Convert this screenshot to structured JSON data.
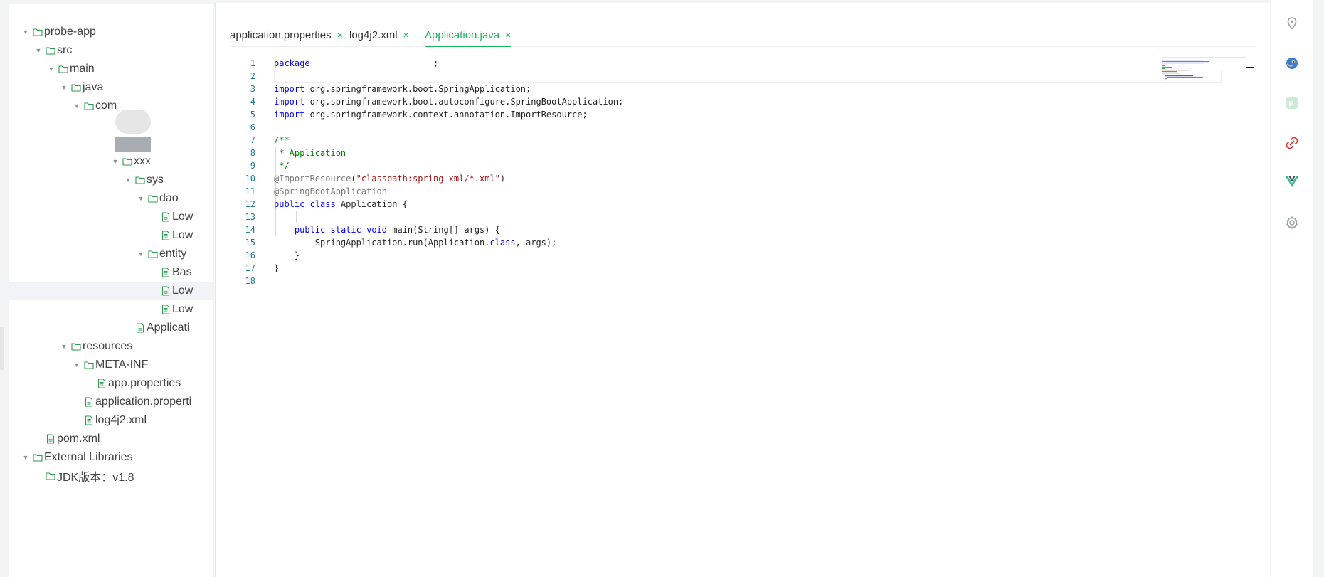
{
  "tree": {
    "items": [
      {
        "label": "probe-app",
        "depth": 0,
        "kind": "folder",
        "expanded": true
      },
      {
        "label": "src",
        "depth": 1,
        "kind": "folder",
        "expanded": true
      },
      {
        "label": "main",
        "depth": 2,
        "kind": "folder",
        "expanded": true
      },
      {
        "label": "java",
        "depth": 3,
        "kind": "folder",
        "expanded": true
      },
      {
        "label": "com",
        "depth": 4,
        "kind": "folder",
        "expanded": true
      },
      {
        "label": "xxx",
        "depth": 7,
        "kind": "folder",
        "expanded": true
      },
      {
        "label": "sys",
        "depth": 8,
        "kind": "folder",
        "expanded": true
      },
      {
        "label": "dao",
        "depth": 9,
        "kind": "folder",
        "expanded": true
      },
      {
        "label": "Low",
        "depth": 10,
        "kind": "file"
      },
      {
        "label": "Low",
        "depth": 10,
        "kind": "file"
      },
      {
        "label": "entity",
        "depth": 9,
        "kind": "folder",
        "expanded": true
      },
      {
        "label": "Bas",
        "depth": 10,
        "kind": "file"
      },
      {
        "label": "Low",
        "depth": 10,
        "kind": "file",
        "selected": true
      },
      {
        "label": "Low",
        "depth": 10,
        "kind": "file"
      },
      {
        "label": "Applicati",
        "depth": 8,
        "kind": "file"
      },
      {
        "label": "resources",
        "depth": 3,
        "kind": "folder",
        "expanded": true
      },
      {
        "label": "META-INF",
        "depth": 4,
        "kind": "folder",
        "expanded": true
      },
      {
        "label": "app.properties",
        "depth": 5,
        "kind": "file"
      },
      {
        "label": "application.properti",
        "depth": 4,
        "kind": "file"
      },
      {
        "label": "log4j2.xml",
        "depth": 4,
        "kind": "file"
      },
      {
        "label": "pom.xml",
        "depth": 1,
        "kind": "file"
      },
      {
        "label": "External Libraries",
        "depth": 0,
        "kind": "folder",
        "expanded": true
      },
      {
        "label": "JDK版本：v1.8",
        "depth": 1,
        "kind": "folder"
      }
    ]
  },
  "tabs": [
    {
      "label": "application.properties",
      "close": "×",
      "active": false
    },
    {
      "label": "log4j2.xml",
      "close": "×",
      "active": false
    },
    {
      "label": "Application.java",
      "close": "×",
      "active": true
    }
  ],
  "editor": {
    "lines": [
      {
        "n": "1",
        "tokens": [
          {
            "t": "package",
            "c": "kw"
          },
          {
            "t": "                        ;",
            "c": ""
          }
        ]
      },
      {
        "n": "2",
        "tokens": []
      },
      {
        "n": "3",
        "tokens": [
          {
            "t": "import",
            "c": "kw"
          },
          {
            "t": " org.springframework.boot.SpringApplication;",
            "c": ""
          }
        ]
      },
      {
        "n": "4",
        "tokens": [
          {
            "t": "import",
            "c": "kw"
          },
          {
            "t": " org.springframework.boot.autoconfigure.SpringBootApplication;",
            "c": ""
          }
        ]
      },
      {
        "n": "5",
        "tokens": [
          {
            "t": "import",
            "c": "kw"
          },
          {
            "t": " org.springframework.context.annotation.ImportResource;",
            "c": ""
          }
        ]
      },
      {
        "n": "6",
        "tokens": []
      },
      {
        "n": "7",
        "tokens": [
          {
            "t": "/**",
            "c": "cm"
          }
        ]
      },
      {
        "n": "8",
        "tokens": [
          {
            "t": " * Application",
            "c": "cm"
          }
        ]
      },
      {
        "n": "9",
        "tokens": [
          {
            "t": " */",
            "c": "cm"
          }
        ]
      },
      {
        "n": "10",
        "tokens": [
          {
            "t": "@ImportResource",
            "c": "an"
          },
          {
            "t": "(",
            "c": ""
          },
          {
            "t": "\"classpath:spring-xml/*.xml\"",
            "c": "st"
          },
          {
            "t": ")",
            "c": ""
          }
        ]
      },
      {
        "n": "11",
        "tokens": [
          {
            "t": "@SpringBootApplication",
            "c": "an"
          }
        ]
      },
      {
        "n": "12",
        "tokens": [
          {
            "t": "public",
            "c": "kw"
          },
          {
            "t": " ",
            "c": ""
          },
          {
            "t": "class",
            "c": "kw"
          },
          {
            "t": " Application {",
            "c": ""
          }
        ]
      },
      {
        "n": "13",
        "tokens": []
      },
      {
        "n": "14",
        "tokens": [
          {
            "t": "    ",
            "c": ""
          },
          {
            "t": "public",
            "c": "kw"
          },
          {
            "t": " ",
            "c": ""
          },
          {
            "t": "static",
            "c": "kw"
          },
          {
            "t": " ",
            "c": ""
          },
          {
            "t": "void",
            "c": "kw"
          },
          {
            "t": " main(String[] args) {",
            "c": ""
          }
        ]
      },
      {
        "n": "15",
        "tokens": [
          {
            "t": "        SpringApplication.run(Application.",
            "c": ""
          },
          {
            "t": "class",
            "c": "kw"
          },
          {
            "t": ", args);",
            "c": ""
          }
        ]
      },
      {
        "n": "16",
        "tokens": [
          {
            "t": "    }",
            "c": ""
          }
        ]
      },
      {
        "n": "17",
        "tokens": [
          {
            "t": "}",
            "c": ""
          }
        ]
      },
      {
        "n": "18",
        "tokens": []
      }
    ]
  },
  "rail": {
    "icons": [
      "location-pin-icon",
      "bird-mascot-icon",
      "slides-app-icon",
      "link-tool-icon",
      "vue-logo-icon",
      "settings-gear-icon"
    ]
  },
  "colors": {
    "accent": "#19b35b",
    "keyword": "#0000ff",
    "comment": "#008000",
    "string": "#a31515",
    "line_number": "#237893",
    "folder_icon": "#2e9a4e",
    "file_icon": "#2e9a4e"
  }
}
